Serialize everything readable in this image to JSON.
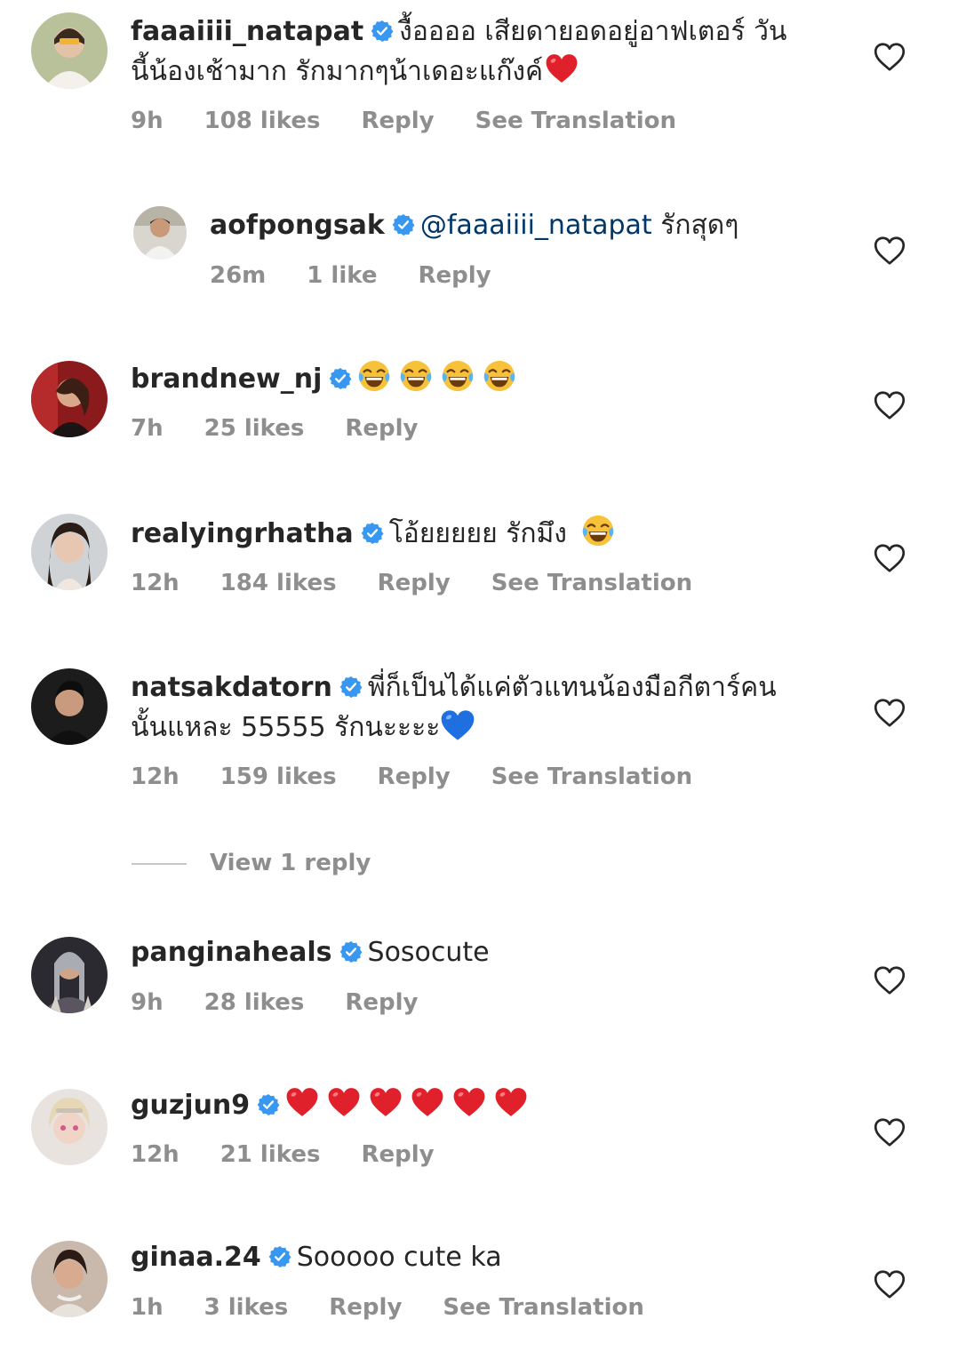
{
  "comments": [
    {
      "username": "faaaiiii_natapat",
      "verified": true,
      "text_line1": "งื้ออออ เสียดายอดอยู่อาฟเตอร์ วัน",
      "text_line2": "นี้น้องเช้ามาก รักมากๆน้าเดอะแก๊งค์",
      "trailing_emoji": "red-heart",
      "time": "9h",
      "likes": "108 likes",
      "reply": "Reply",
      "translation": "See Translation"
    },
    {
      "username": "aofpongsak",
      "verified": true,
      "is_reply": true,
      "mention": "@faaaiiii_natapat",
      "text": "รักสุดๆ",
      "time": "26m",
      "likes": "1 like",
      "reply": "Reply"
    },
    {
      "username": "brandnew_nj",
      "verified": true,
      "emojis": [
        "laughing-tears",
        "laughing-tears",
        "laughing-tears",
        "laughing-tears"
      ],
      "time": "7h",
      "likes": "25 likes",
      "reply": "Reply"
    },
    {
      "username": "realyingrhatha",
      "verified": true,
      "text": "โอ้ยยยยย รักมึง",
      "trailing_emoji": "laughing-tears",
      "time": "12h",
      "likes": "184 likes",
      "reply": "Reply",
      "translation": "See Translation"
    },
    {
      "username": "natsakdatorn",
      "verified": true,
      "text_line1": "พี่ก็เป็นได้แค่ตัวแทนน้องมือกีตาร์คน",
      "text_line2": "นั้นแหละ 55555 รักนะะะะ",
      "trailing_emoji": "blue-heart",
      "time": "12h",
      "likes": "159 likes",
      "reply": "Reply",
      "translation": "See Translation",
      "view_replies": "View 1 reply"
    },
    {
      "username": "panginaheals",
      "verified": true,
      "text": "Sosocute",
      "time": "9h",
      "likes": "28 likes",
      "reply": "Reply"
    },
    {
      "username": "guzjun9",
      "verified": true,
      "emojis": [
        "red-heart",
        "red-heart",
        "red-heart",
        "red-heart",
        "red-heart",
        "red-heart"
      ],
      "time": "12h",
      "likes": "21 likes",
      "reply": "Reply"
    },
    {
      "username": "ginaa.24",
      "verified": true,
      "text": "Sooooo cute ka",
      "time": "1h",
      "likes": "3 likes",
      "reply": "Reply",
      "translation": "See Translation"
    }
  ],
  "colors": {
    "text": "#262626",
    "meta": "#8e8e8e",
    "mention": "#00376b",
    "verified_blue": "#3897f0",
    "heart_red": "#e0202b",
    "blue_heart": "#1f6fe0"
  },
  "icons": {
    "like": "heart-outline-icon",
    "verified": "verified-badge-icon"
  }
}
